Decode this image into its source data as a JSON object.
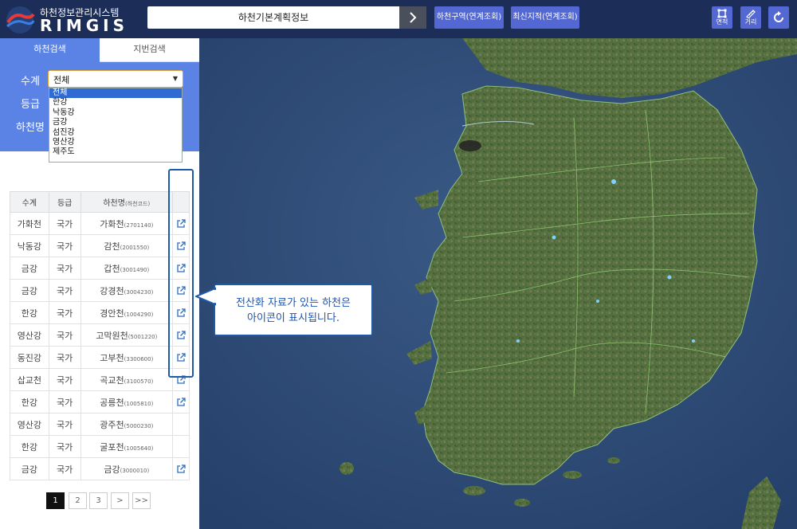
{
  "header": {
    "logo_sub": "하천정보관리시스템",
    "logo_main": "RIMGIS",
    "search_value": "하천기본계획정보",
    "btn_river_zone": "하천구역(연계조회)",
    "btn_cadastral": "최신지적(연계조회)",
    "tool_area": "면적",
    "tool_distance": "거리"
  },
  "tabs": {
    "river_search": "하천검색",
    "lot_search": "지번검색"
  },
  "filters": {
    "system_label": "수계",
    "grade_label": "등급",
    "name_label": "하천명",
    "system_value": "전체",
    "system_options": [
      "전체",
      "한강",
      "낙동강",
      "금강",
      "섬진강",
      "영산강",
      "제주도"
    ]
  },
  "table": {
    "headers": {
      "system": "수계",
      "grade": "등급",
      "name": "하천명",
      "name_suffix": "(하천코드)"
    },
    "rows": [
      {
        "system": "가화천",
        "grade": "국가",
        "name": "가화천",
        "code": "(2701140)",
        "link": true
      },
      {
        "system": "낙동강",
        "grade": "국가",
        "name": "감천",
        "code": "(2001550)",
        "link": true
      },
      {
        "system": "금강",
        "grade": "국가",
        "name": "갑천",
        "code": "(3001490)",
        "link": true
      },
      {
        "system": "금강",
        "grade": "국가",
        "name": "강경천",
        "code": "(3004230)",
        "link": true
      },
      {
        "system": "한강",
        "grade": "국가",
        "name": "경안천",
        "code": "(1004290)",
        "link": true
      },
      {
        "system": "영산강",
        "grade": "국가",
        "name": "고막원천",
        "code": "(5001220)",
        "link": true
      },
      {
        "system": "동진강",
        "grade": "국가",
        "name": "고부천",
        "code": "(3300600)",
        "link": true
      },
      {
        "system": "삽교천",
        "grade": "국가",
        "name": "곡교천",
        "code": "(3100570)",
        "link": true
      },
      {
        "system": "한강",
        "grade": "국가",
        "name": "공릉천",
        "code": "(1005810)",
        "link": true
      },
      {
        "system": "영산강",
        "grade": "국가",
        "name": "광주천",
        "code": "(5000230)",
        "link": false
      },
      {
        "system": "한강",
        "grade": "국가",
        "name": "굴포천",
        "code": "(1005640)",
        "link": false
      },
      {
        "system": "금강",
        "grade": "국가",
        "name": "금강",
        "code": "(3000010)",
        "link": true
      }
    ]
  },
  "pager": {
    "pages": [
      "1",
      "2",
      "3"
    ],
    "next": ">",
    "last": ">>",
    "current": "1"
  },
  "callout": {
    "line1": "전산화 자료가 있는 하천은",
    "line2": "아이콘이 표시됩니다."
  },
  "colors": {
    "header_bg": "#1c2d57",
    "accent": "#5b83e6",
    "button": "#5468d4",
    "callout": "#1e5aa8"
  }
}
